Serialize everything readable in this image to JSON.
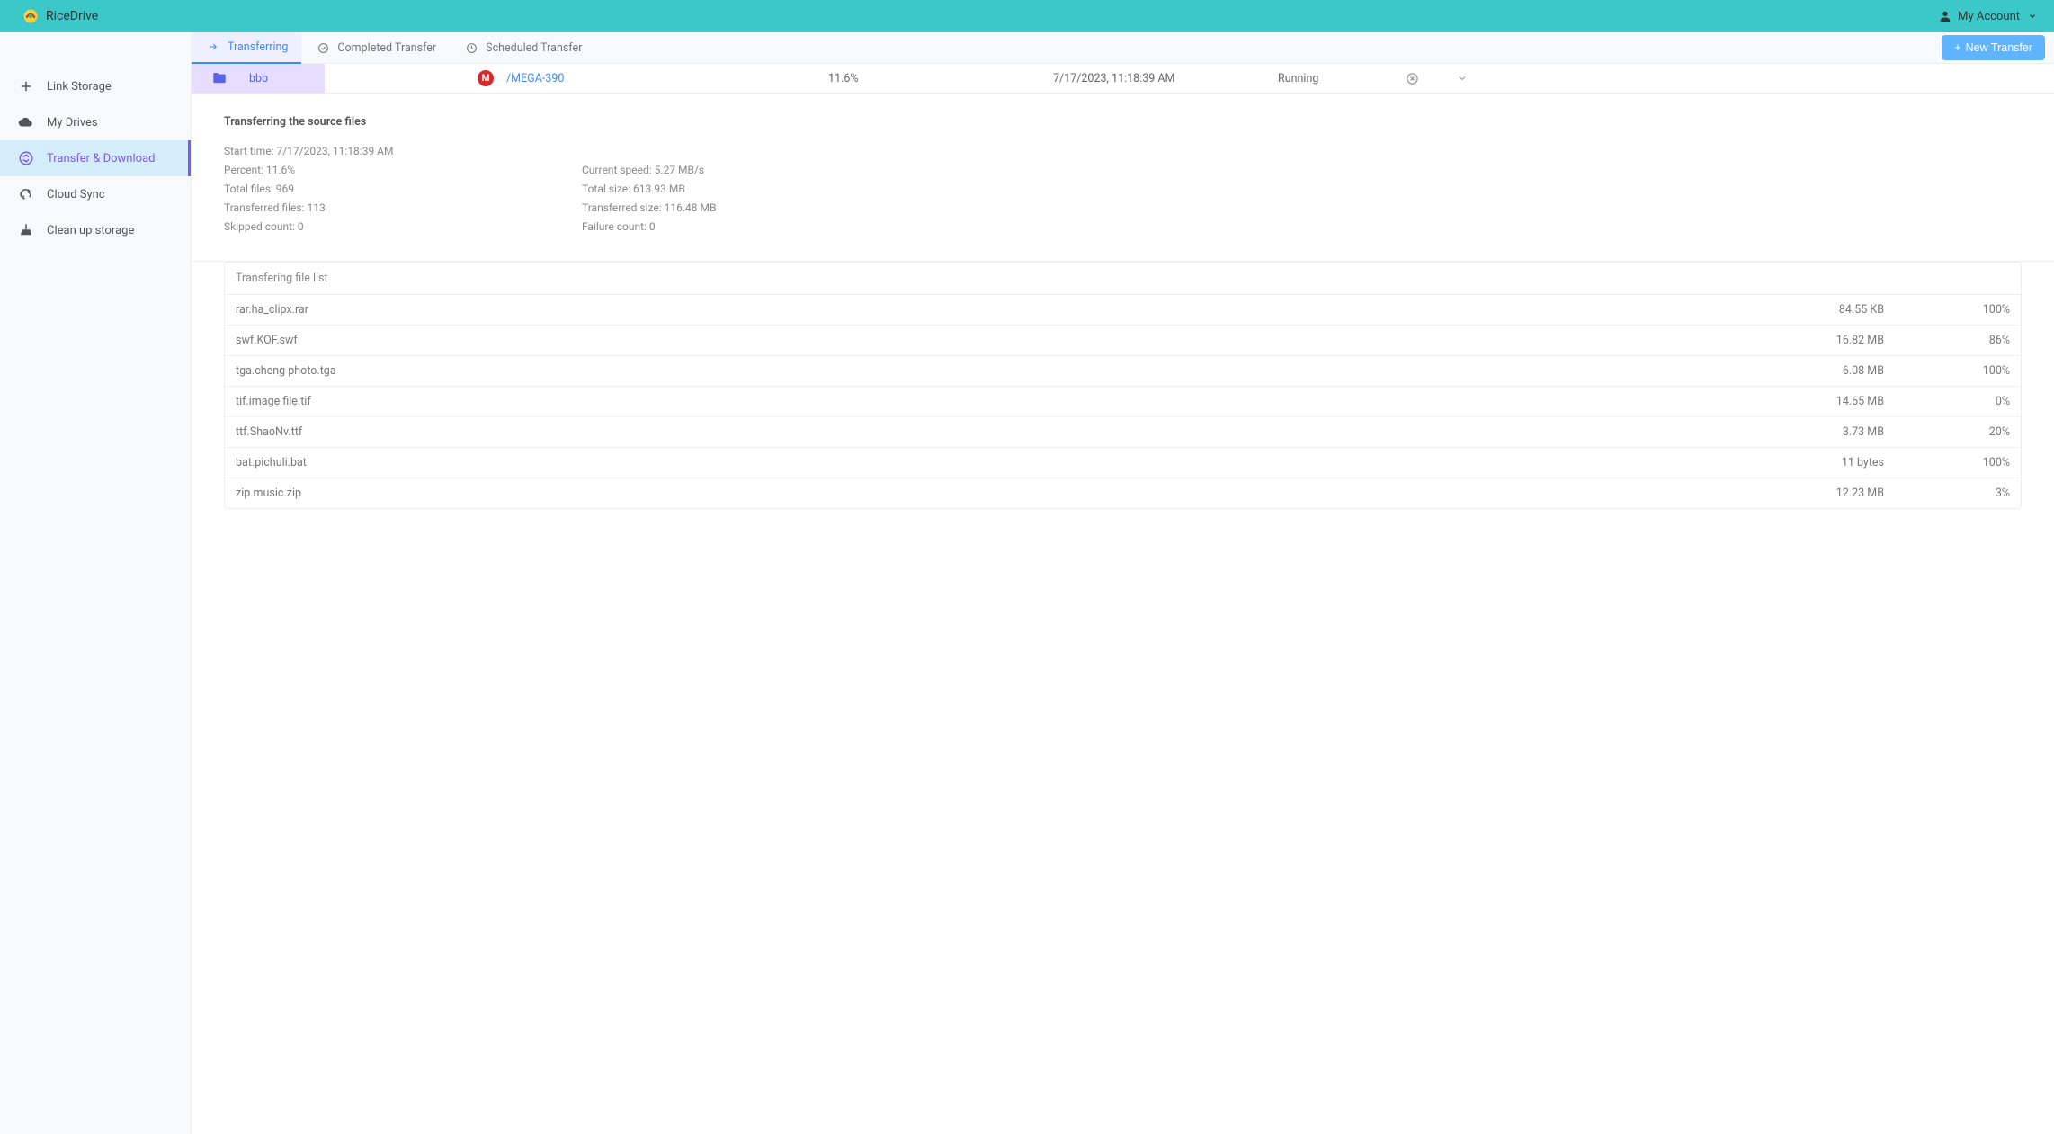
{
  "header": {
    "brand": "RiceDrive",
    "account_label": "My Account"
  },
  "sidebar": {
    "items": [
      {
        "label": "Link Storage"
      },
      {
        "label": "My Drives"
      },
      {
        "label": "Transfer & Download"
      },
      {
        "label": "Cloud Sync"
      },
      {
        "label": "Clean up storage"
      }
    ]
  },
  "tabs": {
    "transferring": "Transferring",
    "completed": "Completed Transfer",
    "scheduled": "Scheduled Transfer",
    "new_transfer": "New Transfer"
  },
  "job": {
    "source": "bbb",
    "dest": "/MEGA-390",
    "percent": "11.6%",
    "time": "7/17/2023, 11:18:39 AM",
    "status": "Running"
  },
  "details": {
    "title": "Transferring the source files",
    "start_time_label": "Start time:",
    "start_time": "7/17/2023, 11:18:39 AM",
    "percent_label": "Percent:",
    "percent": "11.6%",
    "speed_label": "Current speed:",
    "speed": "5.27 MB/s",
    "total_files_label": "Total files:",
    "total_files": "969",
    "total_size_label": "Total size:",
    "total_size": "613.93 MB",
    "transferred_files_label": "Transferred files:",
    "transferred_files": "113",
    "transferred_size_label": "Transferred size:",
    "transferred_size": "116.48 MB",
    "skipped_label": "Skipped count:",
    "skipped": "0",
    "failure_label": "Failure count:",
    "failure": "0"
  },
  "filelist": {
    "header": "Transfering file list",
    "rows": [
      {
        "name": "rar.ha_clipx.rar",
        "size": "84.55 KB",
        "pct": "100%"
      },
      {
        "name": "swf.KOF.swf",
        "size": "16.82 MB",
        "pct": "86%"
      },
      {
        "name": "tga.cheng photo.tga",
        "size": "6.08 MB",
        "pct": "100%"
      },
      {
        "name": "tif.image file.tif",
        "size": "14.65 MB",
        "pct": "0%"
      },
      {
        "name": "ttf.ShaoNv.ttf",
        "size": "3.73 MB",
        "pct": "20%"
      },
      {
        "name": "bat.pichuli.bat",
        "size": "11 bytes",
        "pct": "100%"
      },
      {
        "name": "zip.music.zip",
        "size": "12.23 MB",
        "pct": "3%"
      }
    ]
  }
}
